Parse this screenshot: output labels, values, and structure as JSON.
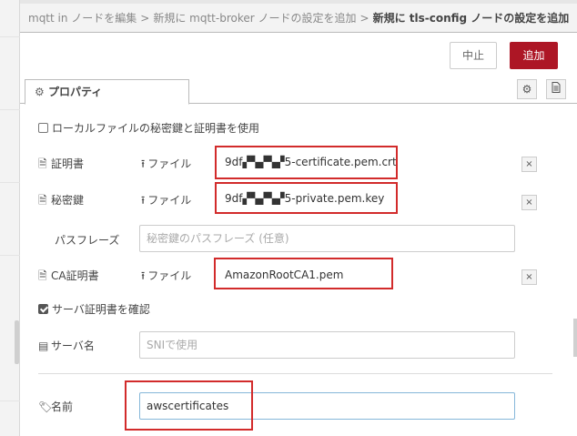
{
  "breadcrumb": {
    "item1": "mqtt in ノードを編集",
    "item2": "新規に mqtt-broker ノードの設定を追加",
    "current": "新規に tls-config ノードの設定を追加",
    "separator": ">"
  },
  "buttons": {
    "cancel": "中止",
    "add": "追加"
  },
  "tabs": {
    "properties_label": "プロパティ"
  },
  "icons": {
    "properties_tab": "gear-icon",
    "settings": "gear-icon",
    "description": "document-icon"
  },
  "form": {
    "use_local_files_label": "ローカルファイルの秘密鍵と証明書を使用",
    "use_local_files_checked": false,
    "cert": {
      "label": "証明書",
      "upload_label": "ファイル",
      "filename": "9df▞▚▞▚▞5-certificate.pem.crt",
      "delete": "×"
    },
    "key": {
      "label": "秘密鍵",
      "upload_label": "ファイル",
      "filename": "9df▞▚▞▚▞5-private.pem.key",
      "delete": "×"
    },
    "passphrase": {
      "label": "パスフレーズ",
      "placeholder": "秘密鍵のパスフレーズ (任意)"
    },
    "ca": {
      "label": "CA証明書",
      "upload_label": "ファイル",
      "filename": "AmazonRootCA1.pem",
      "delete": "×"
    },
    "verify_server_cert_label": "サーバ証明書を確認",
    "verify_server_cert_checked": true,
    "server_name": {
      "label": "サーバ名",
      "placeholder": "SNIで使用"
    },
    "name": {
      "label": "名前",
      "value": "awscertificates"
    }
  },
  "colors": {
    "accent": "#ad1625",
    "highlight_box": "#d22b2b",
    "focus_border": "#85b7d9"
  }
}
